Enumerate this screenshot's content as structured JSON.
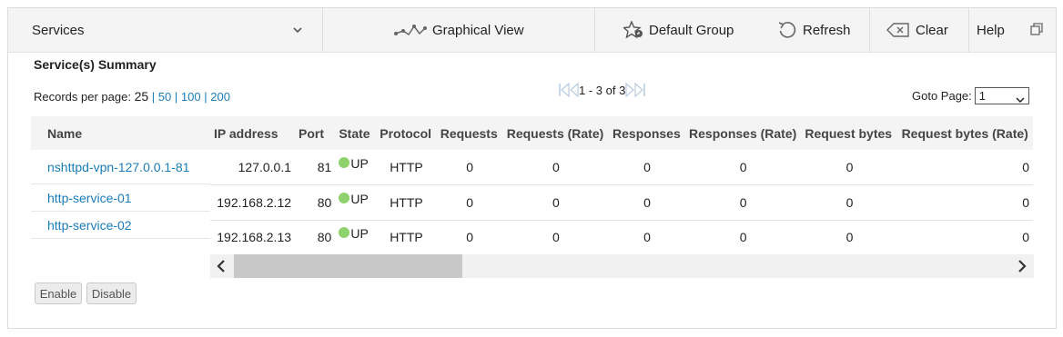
{
  "toolbar": {
    "services_label": "Services",
    "graphical_view_label": "Graphical View",
    "default_group_label": "Default Group",
    "refresh_label": "Refresh",
    "clear_label": "Clear",
    "help_label": "Help"
  },
  "summary_title": "Service(s) Summary",
  "records": {
    "label": "Records per page:",
    "current": "25",
    "options": [
      "50",
      "100",
      "200"
    ],
    "separator": "|"
  },
  "pager": {
    "text": "1 - 3 of 3"
  },
  "goto": {
    "label": "Goto Page:",
    "value": "1"
  },
  "table": {
    "name_header": "Name",
    "columns": [
      "IP address",
      "Port",
      "State",
      "Protocol",
      "Requests",
      "Requests (Rate)",
      "Responses",
      "Responses (Rate)",
      "Request bytes",
      "Request bytes (Rate)"
    ],
    "rows": [
      {
        "name": "nshttpd-vpn-127.0.0.1-81",
        "ip": "127.0.0.1",
        "port": "81",
        "state": "UP",
        "protocol": "HTTP",
        "requests": "0",
        "requests_rate": "0",
        "responses": "0",
        "responses_rate": "0",
        "request_bytes": "0",
        "request_bytes_rate": "0"
      },
      {
        "name": "http-service-01",
        "ip": "192.168.2.12",
        "port": "80",
        "state": "UP",
        "protocol": "HTTP",
        "requests": "0",
        "requests_rate": "0",
        "responses": "0",
        "responses_rate": "0",
        "request_bytes": "0",
        "request_bytes_rate": "0"
      },
      {
        "name": "http-service-02",
        "ip": "192.168.2.13",
        "port": "80",
        "state": "UP",
        "protocol": "HTTP",
        "requests": "0",
        "requests_rate": "0",
        "responses": "0",
        "responses_rate": "0",
        "request_bytes": "0",
        "request_bytes_rate": "0"
      }
    ]
  },
  "buttons": {
    "enable": "Enable",
    "disable": "Disable"
  },
  "colors": {
    "link": "#1a7db8",
    "status_up": "#8fd16b",
    "toolbar_bg": "#f4f4f4"
  },
  "icons": [
    "chevron-down-icon",
    "graph-icon",
    "star-group-icon",
    "refresh-icon",
    "clear-icon",
    "window-icon",
    "first-page-icon",
    "prev-page-icon",
    "next-page-icon",
    "last-page-icon"
  ]
}
